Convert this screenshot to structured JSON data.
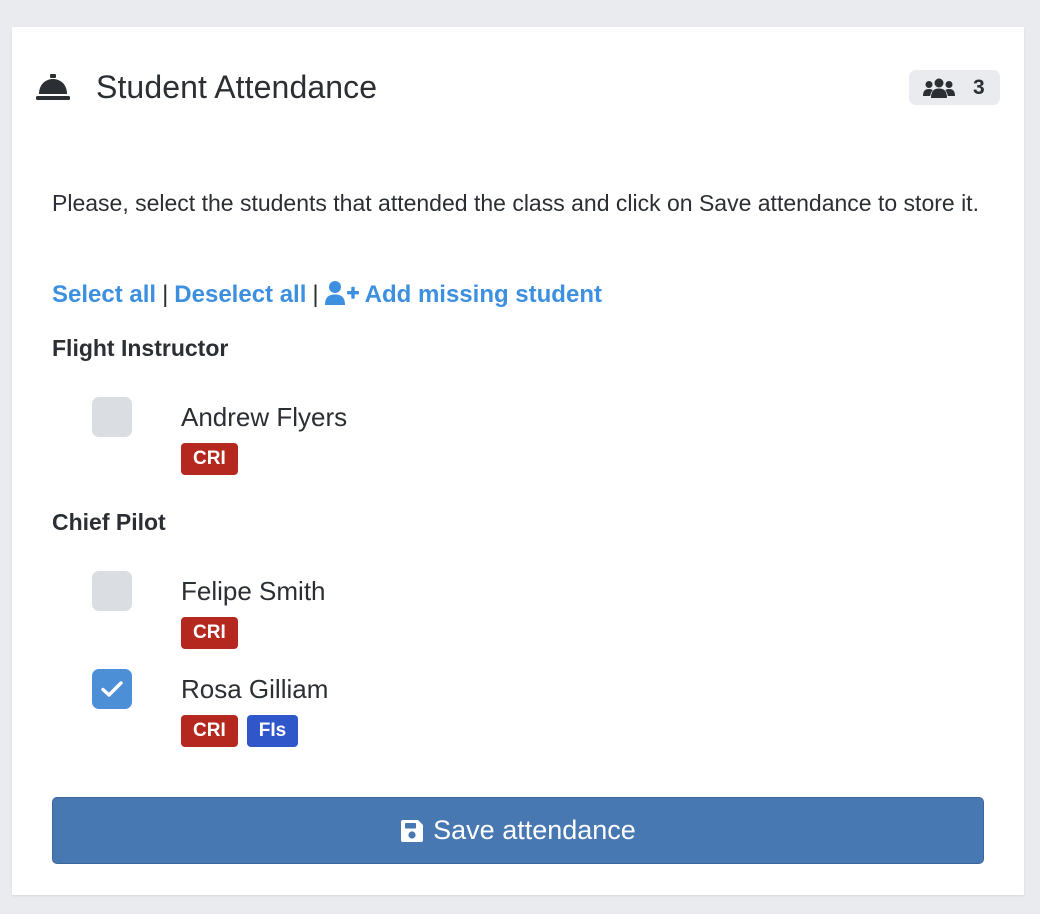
{
  "card": {
    "title": "Student Attendance",
    "student_count": "3",
    "title_icon": "concierge-bell-icon",
    "count_icon": "users-icon"
  },
  "instructions": "Please, select the students that attended the class and click on Save attendance to store it.",
  "actions": {
    "select_all": "Select all",
    "deselect_all": "Deselect all",
    "separator": "|",
    "add_missing": "Add missing student",
    "add_missing_icon": "user-plus-icon"
  },
  "groups": [
    {
      "heading": "Flight Instructor",
      "students": [
        {
          "name": "Andrew Flyers",
          "checked": false,
          "badges": [
            "CRI"
          ]
        }
      ]
    },
    {
      "heading": "Chief Pilot",
      "students": [
        {
          "name": "Felipe Smith",
          "checked": false,
          "badges": [
            "CRI"
          ]
        },
        {
          "name": "Rosa Gilliam",
          "checked": true,
          "badges": [
            "CRI",
            "FIs"
          ]
        }
      ]
    }
  ],
  "save_button": {
    "label": "Save attendance",
    "icon": "floppy-disk-icon"
  },
  "colors": {
    "link": "#3d8fe0",
    "badge_cri": "#b5281f",
    "badge_fis": "#2f57c9",
    "checkbox_checked": "#4d8fd6",
    "checkbox_unchecked": "#dadde1",
    "save_button": "#4878b1",
    "page_background": "#e9ebee"
  }
}
